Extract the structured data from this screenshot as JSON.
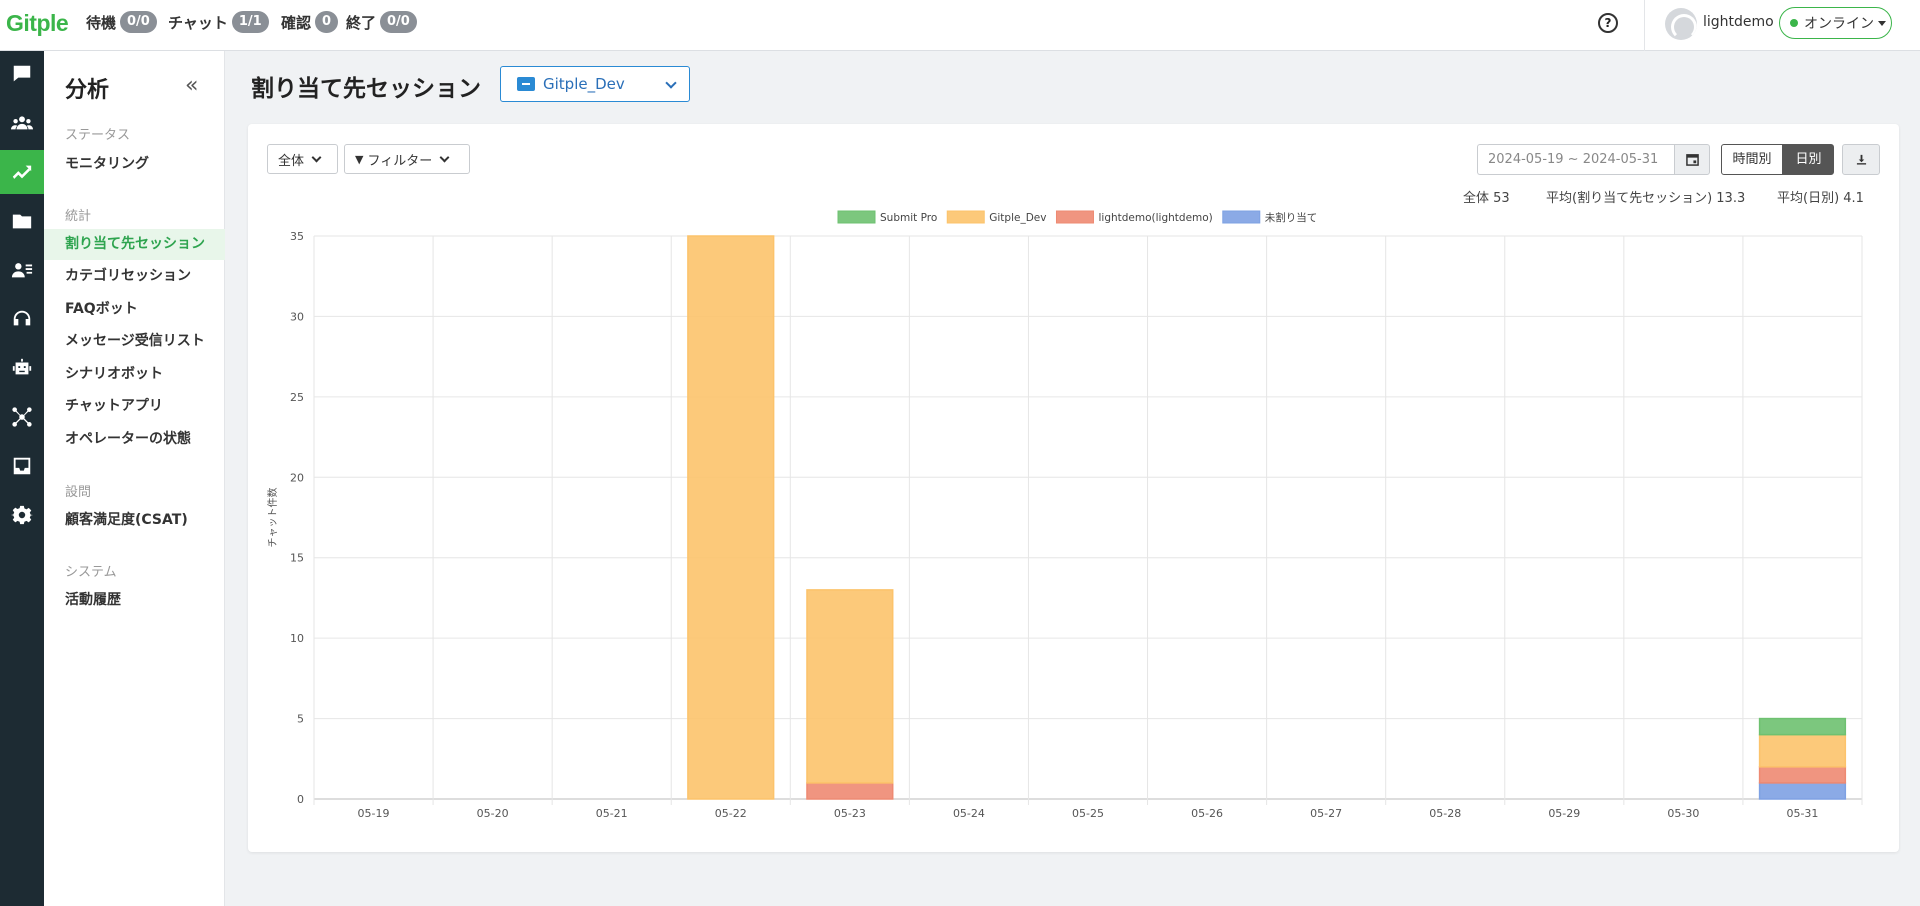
{
  "app": {
    "logo": "Gitple"
  },
  "topbar": {
    "stats": [
      {
        "label": "待機",
        "badge": "0/0"
      },
      {
        "label": "チャット",
        "badge": "1/1"
      },
      {
        "label": "確認",
        "badge": "0"
      },
      {
        "label": "終了",
        "badge": "0/0"
      }
    ],
    "help_icon": "question-circle-icon",
    "username": "lightdemo",
    "status": "オンライン"
  },
  "rail": {
    "items": [
      "chat-icon",
      "people-icon",
      "analytics-icon",
      "folder-icon",
      "contacts-icon",
      "headset-icon",
      "bot-icon",
      "network-icon",
      "inbox-icon",
      "gear-icon"
    ],
    "active_index": 2
  },
  "sidebar": {
    "title": "分析",
    "sections": [
      {
        "label": "ステータス",
        "items": [
          "モニタリング"
        ]
      },
      {
        "label": "統計",
        "items": [
          "割り当て先セッション",
          "カテゴリセッション",
          "FAQボット",
          "メッセージ受信リスト",
          "シナリオボット",
          "チャットアプリ",
          "オペレーターの状態"
        ]
      },
      {
        "label": "設問",
        "items": [
          "顧客満足度(CSAT)"
        ]
      },
      {
        "label": "システム",
        "items": [
          "活動履歴"
        ]
      }
    ],
    "active_item": "割り当て先セッション"
  },
  "main": {
    "title": "割り当て先セッション",
    "session_select": "Gitple_Dev",
    "filter_all": "全体",
    "filter_label": "フィルター",
    "date_range": "2024-05-19 ~ 2024-05-31",
    "view_hourly": "時間別",
    "view_daily": "日別",
    "stat_total": "全体 53",
    "stat_avg_session": "平均(割り当て先セッション) 13.3",
    "stat_avg_daily": "平均(日別) 4.1"
  },
  "chart_data": {
    "type": "bar",
    "stacked": true,
    "ylabel": "チャット件数",
    "ylim": [
      0,
      35
    ],
    "yticks": [
      0,
      5,
      10,
      15,
      20,
      25,
      30,
      35
    ],
    "grid": true,
    "legend_position": "top",
    "categories": [
      "05-19",
      "05-20",
      "05-21",
      "05-22",
      "05-23",
      "05-24",
      "05-25",
      "05-26",
      "05-27",
      "05-28",
      "05-29",
      "05-30",
      "05-31"
    ],
    "series": [
      {
        "name": "未割り当て",
        "color": "#7ea1e3",
        "values": [
          0,
          0,
          0,
          0,
          0,
          0,
          0,
          0,
          0,
          0,
          0,
          0,
          1
        ]
      },
      {
        "name": "lightdemo(lightdemo)",
        "color": "#ee8a72",
        "values": [
          0,
          0,
          0,
          0,
          1,
          0,
          0,
          0,
          0,
          0,
          0,
          0,
          1
        ]
      },
      {
        "name": "Gitple_Dev",
        "color": "#fcc36b",
        "values": [
          0,
          0,
          0,
          35,
          12,
          0,
          0,
          0,
          0,
          0,
          0,
          0,
          2
        ]
      },
      {
        "name": "Submit Pro",
        "color": "#6ec170",
        "values": [
          0,
          0,
          0,
          0,
          0,
          0,
          0,
          0,
          0,
          0,
          0,
          0,
          1
        ]
      }
    ],
    "legend_order": [
      "Submit Pro",
      "Gitple_Dev",
      "lightdemo(lightdemo)",
      "未割り当て"
    ]
  }
}
